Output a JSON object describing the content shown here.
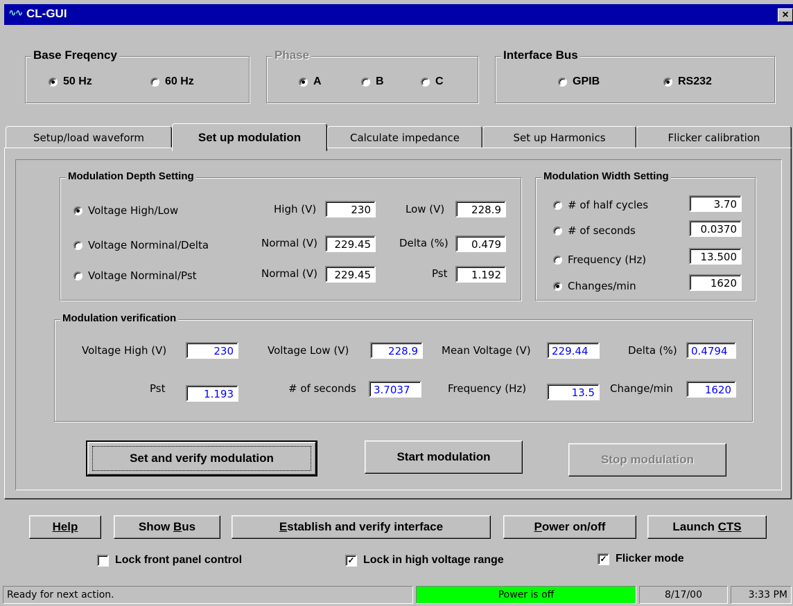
{
  "window": {
    "title": "CL-GUI",
    "icon": "waveform-icon",
    "close_label": "×"
  },
  "base_frequency": {
    "label": "Base Freqency",
    "options": [
      {
        "label": "50 Hz",
        "selected": true
      },
      {
        "label": "60 Hz",
        "selected": false
      }
    ]
  },
  "phase": {
    "label": "Phase",
    "options": [
      {
        "label": "A",
        "selected": true
      },
      {
        "label": "B",
        "selected": false
      },
      {
        "label": "C",
        "selected": false
      }
    ]
  },
  "interface_bus": {
    "label": "Interface Bus",
    "options": [
      {
        "label": "GPIB",
        "selected": false
      },
      {
        "label": "RS232",
        "selected": true
      }
    ]
  },
  "tabs": [
    {
      "label": "Setup/load waveform",
      "active": false
    },
    {
      "label": "Set up modulation",
      "active": true
    },
    {
      "label": "Calculate impedance",
      "active": false
    },
    {
      "label": "Set up Harmonics",
      "active": false
    },
    {
      "label": "Flicker calibration",
      "active": false
    }
  ],
  "depth": {
    "label": "Modulation Depth Setting",
    "rows": [
      {
        "option": "Voltage High/Low",
        "selected": true,
        "l1": "High (V)",
        "v1": "230",
        "l2": "Low (V)",
        "v2": "228.9"
      },
      {
        "option": "Voltage Norminal/Delta",
        "selected": false,
        "l1": "Normal (V)",
        "v1": "229.45",
        "l2": "Delta (%)",
        "v2": "0.479"
      },
      {
        "option": "Voltage Norminal/Pst",
        "selected": false,
        "l1": "Normal (V)",
        "v1": "229.45",
        "l2": "Pst",
        "v2": "1.192"
      }
    ]
  },
  "width": {
    "label": "Modulation Width Setting",
    "rows": [
      {
        "option": "# of half cycles",
        "selected": false,
        "value": "3.70"
      },
      {
        "option": "# of seconds",
        "selected": false,
        "value": "0.0370"
      },
      {
        "option": "Frequency (Hz)",
        "selected": false,
        "value": "13.500"
      },
      {
        "option": "Changes/min",
        "selected": true,
        "value": "1620"
      }
    ]
  },
  "verification": {
    "label": "Modulation verification",
    "row1": [
      {
        "label": "Voltage High (V)",
        "value": "230"
      },
      {
        "label": "Voltage Low (V)",
        "value": "228.9"
      },
      {
        "label": "Mean Voltage (V)",
        "value": "229.44"
      },
      {
        "label": "Delta (%)",
        "value": "0.4794"
      }
    ],
    "row2": [
      {
        "label": "Pst",
        "value": "1.193"
      },
      {
        "label": "# of seconds",
        "value": "3.7037"
      },
      {
        "label": "Frequency (Hz)",
        "value": "13.5"
      },
      {
        "label": "Change/min",
        "value": "1620"
      }
    ]
  },
  "actions": {
    "set_verify": "Set and verify modulation",
    "start": "Start modulation",
    "stop": "Stop modulation"
  },
  "bottom_buttons": {
    "help": "Help",
    "show_bus_prefix": "Show ",
    "show_bus_key": "B",
    "show_bus_rest": "us",
    "establish_key": "E",
    "establish_rest": "stablish and verify interface",
    "power_key": "P",
    "power_rest": "ower on/off",
    "launch_prefix": "Launch ",
    "launch_key": "CTS"
  },
  "checkboxes": [
    {
      "label": "Lock front panel control",
      "checked": false
    },
    {
      "label": "Lock in high voltage range",
      "checked": true
    },
    {
      "label": "Flicker mode",
      "checked": true
    }
  ],
  "status": {
    "message": "Ready for next action.",
    "power": "Power is off",
    "date": "8/17/00",
    "time": "3:33 PM",
    "power_color": "#00ff00"
  }
}
